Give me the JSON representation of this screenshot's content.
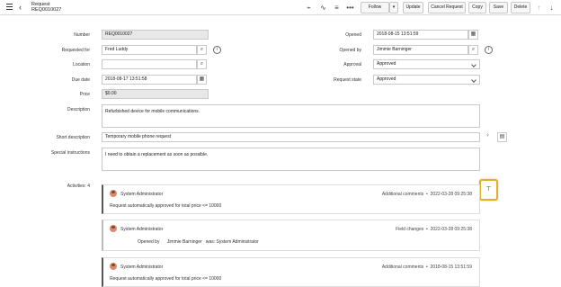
{
  "header": {
    "title": "Request",
    "number": "REQ0010027",
    "buttons": {
      "follow": "Follow",
      "update": "Update",
      "cancel_request": "Cancel Request",
      "copy": "Copy",
      "save": "Save",
      "delete": "Delete"
    },
    "icons": [
      "menu-icon",
      "back-icon",
      "attachment-icon",
      "activity-icon",
      "settings-icon",
      "more-icon",
      "chevron-down-icon",
      "arrow-up-icon",
      "arrow-down-icon"
    ]
  },
  "form": {
    "number_label": "Number",
    "number_value": "REQ0010027",
    "requested_for_label": "Requested for",
    "requested_for_value": "Fred Luddy",
    "location_label": "Location",
    "location_value": "",
    "due_date_label": "Due date",
    "due_date_value": "2018-08-17 13:51:58",
    "price_label": "Price",
    "price_value": "$0.00",
    "opened_label": "Opened",
    "opened_value": "2018-08-15 13:51:59",
    "opened_by_label": "Opened by",
    "opened_by_value": "Jimmie Barninger",
    "approval_label": "Approval",
    "approval_value": "Approved",
    "request_state_label": "Request state",
    "request_state_value": "Approved",
    "description_label": "Description",
    "description_value": "Refurbished device for mobile communications.",
    "short_description_label": "Short description",
    "short_description_value": "Temporary mobile phone request",
    "special_instructions_label": "Special instructions",
    "special_instructions_value": "I need to obtain a replacement as soon as possible."
  },
  "activities": {
    "label": "Activities: 4",
    "entries": [
      {
        "author": "System Administrator",
        "type": "Additional comments",
        "timestamp": "2022-03-28 09:25:38",
        "message": "Request automatically approved for total price <= 10000"
      },
      {
        "author": "System Administrator",
        "type": "Field changes",
        "timestamp": "2022-03-28 09:25:38",
        "field_name": "Opened by",
        "field_value": "Jimmie Barninger",
        "was_text": "was: System Administrator"
      },
      {
        "author": "System Administrator",
        "type": "Additional comments",
        "timestamp": "2018-08-15 13:51:59",
        "message": "Request automatically approved for total price <= 10000"
      }
    ]
  },
  "colors": {
    "highlight": "#e1b12c",
    "readonly_bg": "#e8e8e8"
  }
}
